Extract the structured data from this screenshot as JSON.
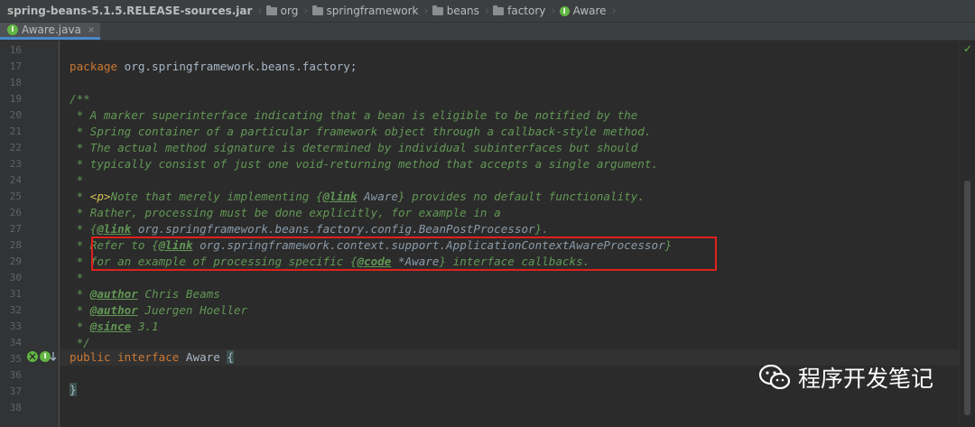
{
  "breadcrumbs": [
    {
      "label": "spring-beans-5.1.5.RELEASE-sources.jar",
      "icon": "jar-icon"
    },
    {
      "label": "org",
      "icon": "folder-icon"
    },
    {
      "label": "springframework",
      "icon": "folder-icon"
    },
    {
      "label": "beans",
      "icon": "folder-icon"
    },
    {
      "label": "factory",
      "icon": "folder-icon"
    },
    {
      "label": "Aware",
      "icon": "interface-icon"
    }
  ],
  "tab": {
    "label": "Aware.java",
    "close": "×"
  },
  "line_numbers": [
    "16",
    "17",
    "18",
    "19",
    "20",
    "21",
    "22",
    "23",
    "24",
    "25",
    "26",
    "27",
    "28",
    "29",
    "30",
    "31",
    "32",
    "33",
    "34",
    "35",
    "36",
    "37",
    "38"
  ],
  "code": {
    "l17": {
      "kw": "package",
      "rest": " org.springframework.beans.factory;"
    },
    "l19": "/**",
    "l20": " * A marker superinterface indicating that a bean is eligible to be notified by the",
    "l21": " * Spring container of a particular framework object through a callback-style method.",
    "l22": " * The actual method signature is determined by individual subinterfaces but should",
    "l23": " * typically consist of just one void-returning method that accepts a single argument.",
    "l24": " *",
    "l25": {
      "a": " * ",
      "b": "<p>",
      "c": "Note that merely implementing {",
      "d": "@link",
      "e": " Aware",
      "f": "} provides no default functionality."
    },
    "l26": " * Rather, processing must be done explicitly, for example in a",
    "l27": {
      "a": " * {",
      "b": "@link",
      "c": " org.springframework.beans.factory.config.BeanPostProcessor",
      "d": "}."
    },
    "l28": {
      "a": " * Refer to {",
      "b": "@link",
      "c": " org.springframework.context.support.ApplicationContextAwareProcessor",
      "d": "}"
    },
    "l29": {
      "a": " * for an example of processing specific {",
      "b": "@code",
      "c": " *Aware",
      "d": "} interface callbacks."
    },
    "l30": " *",
    "l31": {
      "a": " * ",
      "b": "@author",
      "c": " Chris Beams"
    },
    "l32": {
      "a": " * ",
      "b": "@author",
      "c": " Juergen Hoeller"
    },
    "l33": {
      "a": " * ",
      "b": "@since",
      "c": " 3.1"
    },
    "l34": " */",
    "l35": {
      "kw1": "public",
      "kw2": "interface",
      "name": " Aware ",
      "brace": "{"
    },
    "l37": "}"
  },
  "watermark": {
    "text": "程序开发笔记"
  },
  "colors": {
    "keyword": "#cc7832",
    "comment": "#629755",
    "highlight": "#e0201c",
    "bg": "#2b2b2b"
  }
}
